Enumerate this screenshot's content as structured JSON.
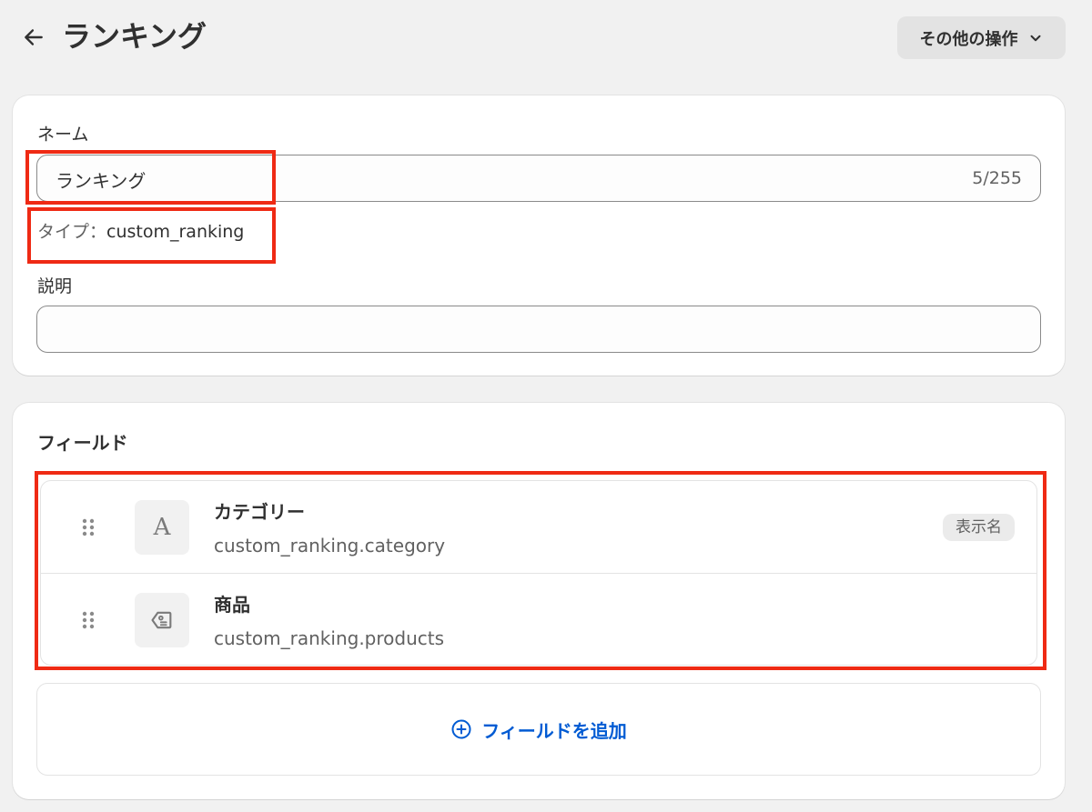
{
  "header": {
    "title": "ランキング",
    "back_icon": "arrow-left-icon",
    "more_actions_label": "その他の操作",
    "more_actions_icon": "chevron-down-icon"
  },
  "definition": {
    "name_label": "ネーム",
    "name_value": "ランキング",
    "name_counter": "5/255",
    "type_prefix": "タイプ：",
    "type_value": "custom_ranking",
    "description_label": "説明",
    "description_value": ""
  },
  "fields": {
    "title": "フィールド",
    "items": [
      {
        "name": "カテゴリー",
        "key": "custom_ranking.category",
        "icon": "text-a-icon",
        "glyph": "A",
        "badge": "表示名"
      },
      {
        "name": "商品",
        "key": "custom_ranking.products",
        "icon": "product-tag-icon"
      }
    ],
    "add_label": "フィールドを追加",
    "add_icon": "plus-circle-icon"
  },
  "colors": {
    "accent": "#005bd3",
    "highlight": "#ef2a14",
    "background": "#f1f1f1"
  }
}
